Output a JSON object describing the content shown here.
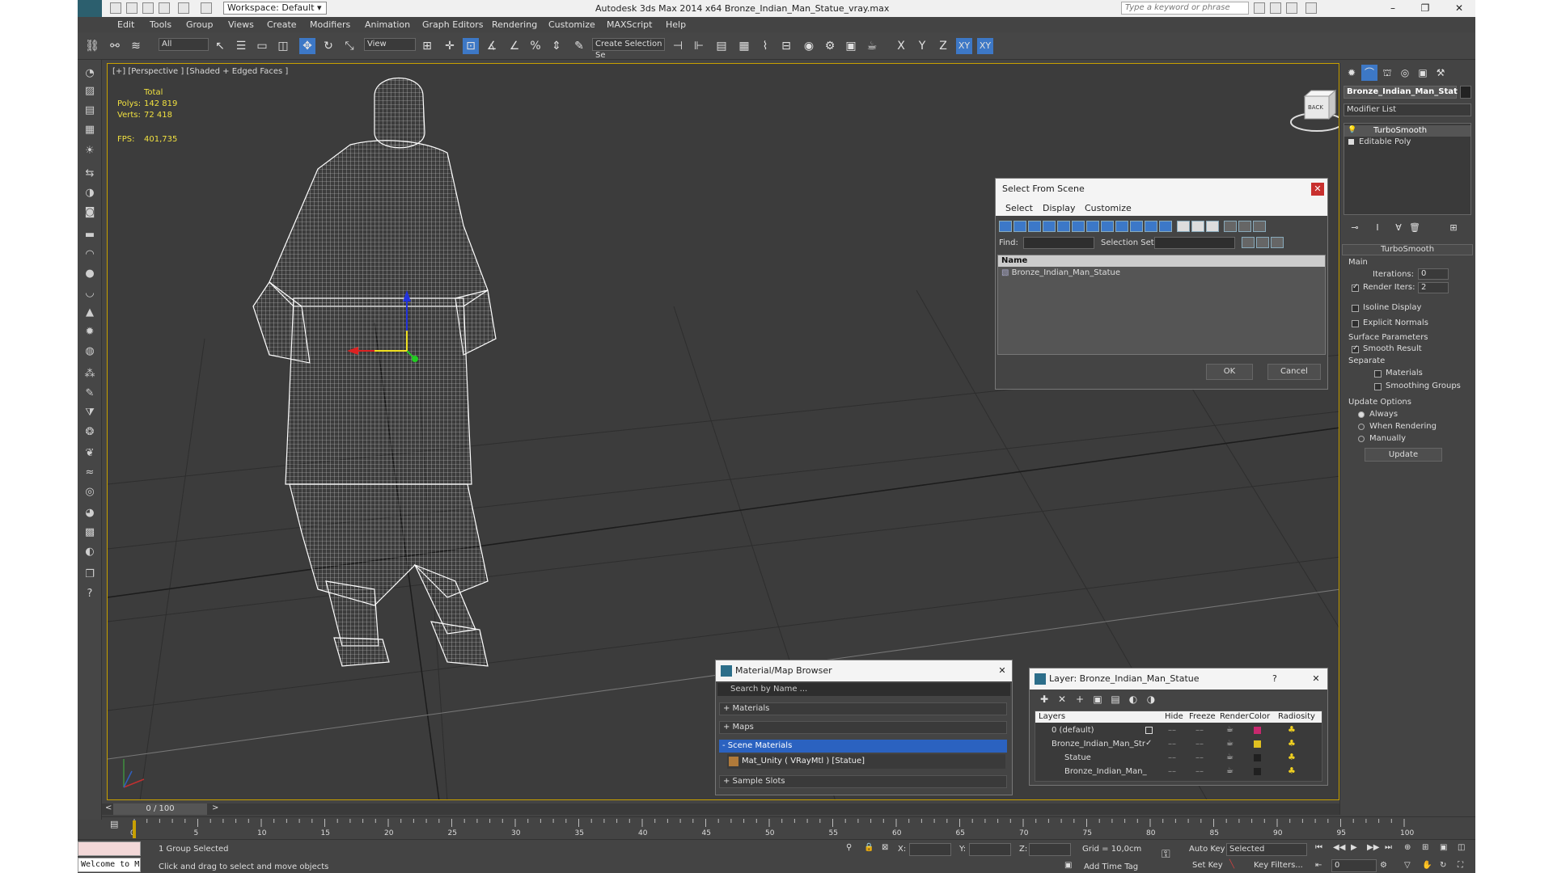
{
  "window": {
    "title": "Autodesk 3ds Max  2014 x64    Bronze_Indian_Man_Statue_vray.max",
    "workspace": "Workspace: Default",
    "search_placeholder": "Type a keyword or phrase",
    "controls": [
      "–",
      "❐",
      "✕"
    ]
  },
  "menu": [
    "Edit",
    "Tools",
    "Group",
    "Views",
    "Create",
    "Modifiers",
    "Animation",
    "Graph Editors",
    "Rendering",
    "Customize",
    "MAXScript",
    "Help"
  ],
  "toolbar": {
    "filter": "All",
    "refcoord": "View",
    "named_sel": "Create Selection Se",
    "axes": [
      "X",
      "Y",
      "Z",
      "XY",
      "XY"
    ]
  },
  "viewport": {
    "label": "[+] [Perspective ] [Shaded + Edged Faces ]",
    "stats": {
      "total": "Total",
      "polys_label": "Polys:",
      "polys": "142 819",
      "verts_label": "Verts:",
      "verts": "72 418",
      "fps_label": "FPS:",
      "fps": "401,735"
    },
    "cube_label": "BACK"
  },
  "select_dialog": {
    "title": "Select From Scene",
    "menu": [
      "Select",
      "Display",
      "Customize"
    ],
    "find_label": "Find:",
    "selset_label": "Selection Set:",
    "col_name": "Name",
    "items": [
      "Bronze_Indian_Man_Statue"
    ],
    "ok": "OK",
    "cancel": "Cancel"
  },
  "material_browser": {
    "title": "Material/Map Browser",
    "search": "Search by Name ...",
    "sections": [
      "+ Materials",
      "+ Maps",
      "- Scene Materials"
    ],
    "material": "Mat_Unity  ( VRayMtl )  [Statue]",
    "sample": "+ Sample Slots"
  },
  "layer_dialog": {
    "title": "Layer: Bronze_Indian_Man_Statue",
    "help": "?",
    "columns": [
      "Layers",
      "Hide",
      "Freeze",
      "Render",
      "Color",
      "Radiosity"
    ],
    "rows": [
      {
        "name": "0 (default)",
        "color": "#c8286e"
      },
      {
        "name": "Bronze_Indian_Man_Str",
        "color": "#e0c020"
      },
      {
        "name": "Statue",
        "color": "#202020"
      },
      {
        "name": "Bronze_Indian_Man_",
        "color": "#202020"
      }
    ]
  },
  "command_panel": {
    "object_name": "Bronze_Indian_Man_Stat",
    "modifier_list": "Modifier List",
    "stack": [
      "TurboSmooth",
      "Editable Poly"
    ],
    "rollout": "TurboSmooth",
    "main": "Main",
    "iterations_label": "Iterations:",
    "iterations": "0",
    "render_iters_label": "Render Iters:",
    "render_iters": "2",
    "isoline": "Isoline Display",
    "explicit": "Explicit Normals",
    "surface": "Surface Parameters",
    "smooth": "Smooth Result",
    "separate": "Separate",
    "materials": "Materials",
    "smoothing": "Smoothing Groups",
    "update_opts": "Update Options",
    "always": "Always",
    "when_rendering": "When Rendering",
    "manually": "Manually",
    "update": "Update"
  },
  "timeline": {
    "frame": "0 / 100",
    "ticks": [
      "0",
      "5",
      "10",
      "15",
      "20",
      "25",
      "30",
      "35",
      "40",
      "45",
      "50",
      "55",
      "60",
      "65",
      "70",
      "75",
      "80",
      "85",
      "90",
      "95",
      "100"
    ]
  },
  "status": {
    "welcome": "Welcome to M",
    "selected": "1 Group Selected",
    "prompt": "Click and drag to select and move objects",
    "x_label": "X:",
    "y_label": "Y:",
    "z_label": "Z:",
    "grid": "Grid = 10,0cm",
    "add_time_tag": "Add Time Tag",
    "auto_key": "Auto Key",
    "set_key": "Set Key",
    "selected_dropdown": "Selected",
    "key_filters": "Key Filters...",
    "frame_field": "0"
  }
}
